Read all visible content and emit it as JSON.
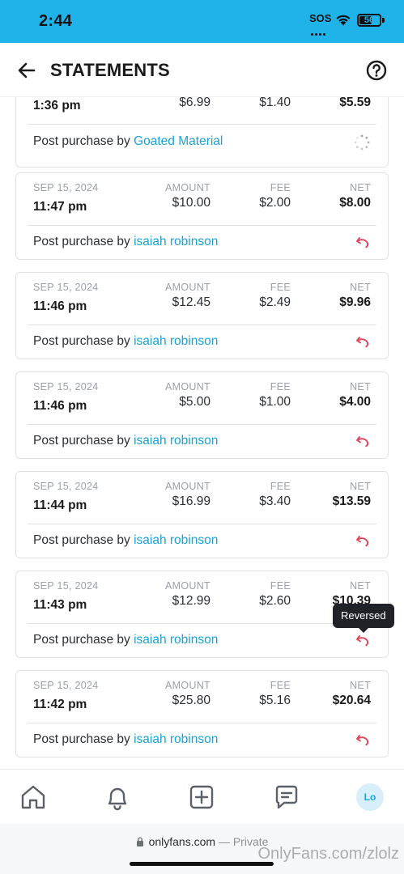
{
  "status_bar": {
    "time": "2:44",
    "sos": "SOS",
    "battery": "56"
  },
  "header": {
    "title": "STATEMENTS"
  },
  "columns": {
    "amount": "AMOUNT",
    "fee": "FEE",
    "net": "NET"
  },
  "partial_entry": {
    "time": "1:36 pm",
    "amount": "$6.99",
    "fee": "$1.40",
    "net": "$5.59",
    "desc_prefix": "Post purchase by",
    "user": "Goated Material",
    "status_icon": "loading-icon"
  },
  "entries": [
    {
      "date": "SEP 15, 2024",
      "time": "11:47 pm",
      "amount": "$10.00",
      "fee": "$2.00",
      "net": "$8.00",
      "desc_prefix": "Post purchase by",
      "user": "isaiah robinson",
      "status_icon": "reverse-icon"
    },
    {
      "date": "SEP 15, 2024",
      "time": "11:46 pm",
      "amount": "$12.45",
      "fee": "$2.49",
      "net": "$9.96",
      "desc_prefix": "Post purchase by",
      "user": "isaiah robinson",
      "status_icon": "reverse-icon"
    },
    {
      "date": "SEP 15, 2024",
      "time": "11:46 pm",
      "amount": "$5.00",
      "fee": "$1.00",
      "net": "$4.00",
      "desc_prefix": "Post purchase by",
      "user": "isaiah robinson",
      "status_icon": "reverse-icon"
    },
    {
      "date": "SEP 15, 2024",
      "time": "11:44 pm",
      "amount": "$16.99",
      "fee": "$3.40",
      "net": "$13.59",
      "desc_prefix": "Post purchase by",
      "user": "isaiah robinson",
      "status_icon": "reverse-icon"
    },
    {
      "date": "SEP 15, 2024",
      "time": "11:43 pm",
      "amount": "$12.99",
      "fee": "$2.60",
      "net": "$10.39",
      "desc_prefix": "Post purchase by",
      "user": "isaiah robinson",
      "status_icon": "reverse-icon"
    },
    {
      "date": "SEP 15, 2024",
      "time": "11:42 pm",
      "amount": "$25.80",
      "fee": "$5.16",
      "net": "$20.64",
      "desc_prefix": "Post purchase by",
      "user": "isaiah robinson",
      "status_icon": "reverse-icon"
    }
  ],
  "tooltip": {
    "text": "Reversed"
  },
  "bottom_nav": {
    "avatar_initials": "Lo",
    "items": [
      "home-icon",
      "bell-icon",
      "add-post-icon",
      "messages-icon"
    ]
  },
  "browser": {
    "url": "onlyfans.com",
    "private_label": "— Private"
  },
  "watermark": "OnlyFans.com/zlolz",
  "colors": {
    "status_bar": "#1fb3ea",
    "link": "#1aa3d8",
    "reverse": "#e0455a"
  }
}
